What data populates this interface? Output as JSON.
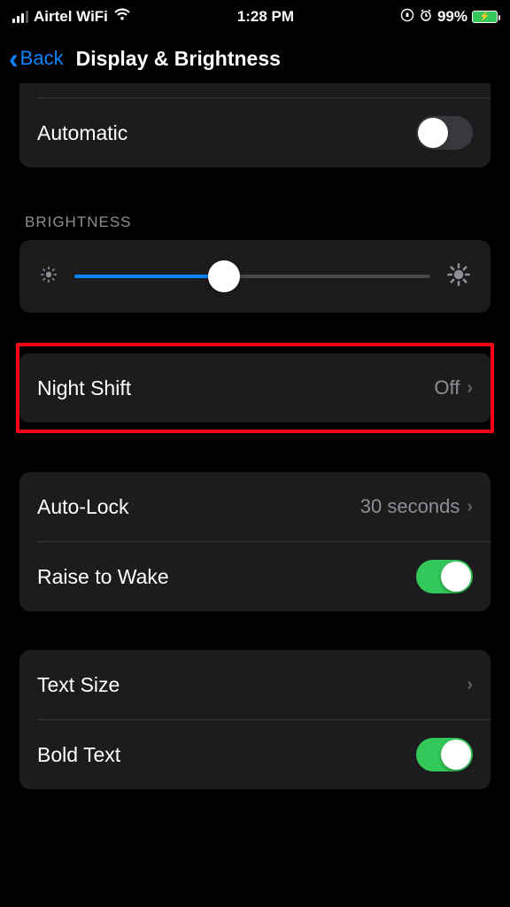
{
  "status": {
    "carrier": "Airtel WiFi",
    "time": "1:28 PM",
    "battery": "99%"
  },
  "nav": {
    "back": "Back",
    "title": "Display & Brightness"
  },
  "rows": {
    "automatic": "Automatic",
    "brightnessHeader": "BRIGHTNESS",
    "nightShift": {
      "label": "Night Shift",
      "value": "Off"
    },
    "autoLock": {
      "label": "Auto-Lock",
      "value": "30 seconds"
    },
    "raiseToWake": "Raise to Wake",
    "textSize": "Text Size",
    "boldText": "Bold Text"
  }
}
